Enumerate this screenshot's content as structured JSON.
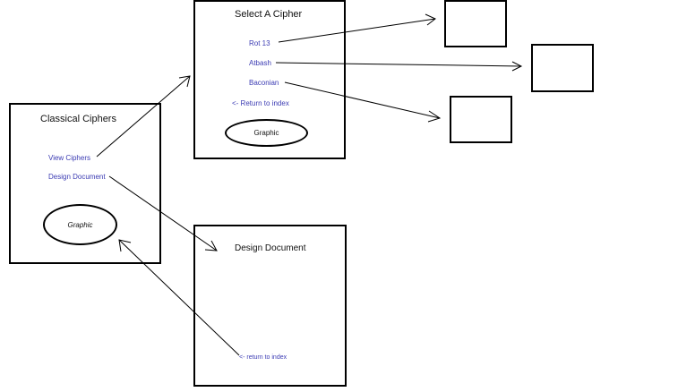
{
  "index_page": {
    "title": "Classical Ciphers",
    "links": [
      "View Ciphers",
      "Design Document"
    ],
    "graphic_label": "Graphic"
  },
  "cipher_page": {
    "title": "Select A Cipher",
    "links": [
      "Rot 13",
      "Atbash",
      "Baconian",
      "<- Return to index"
    ],
    "graphic_label": "Graphic"
  },
  "design_page": {
    "title": "Design Document",
    "return_link": "<- return to index"
  },
  "colors": {
    "link": "#3b3bb3",
    "line": "#000000"
  }
}
